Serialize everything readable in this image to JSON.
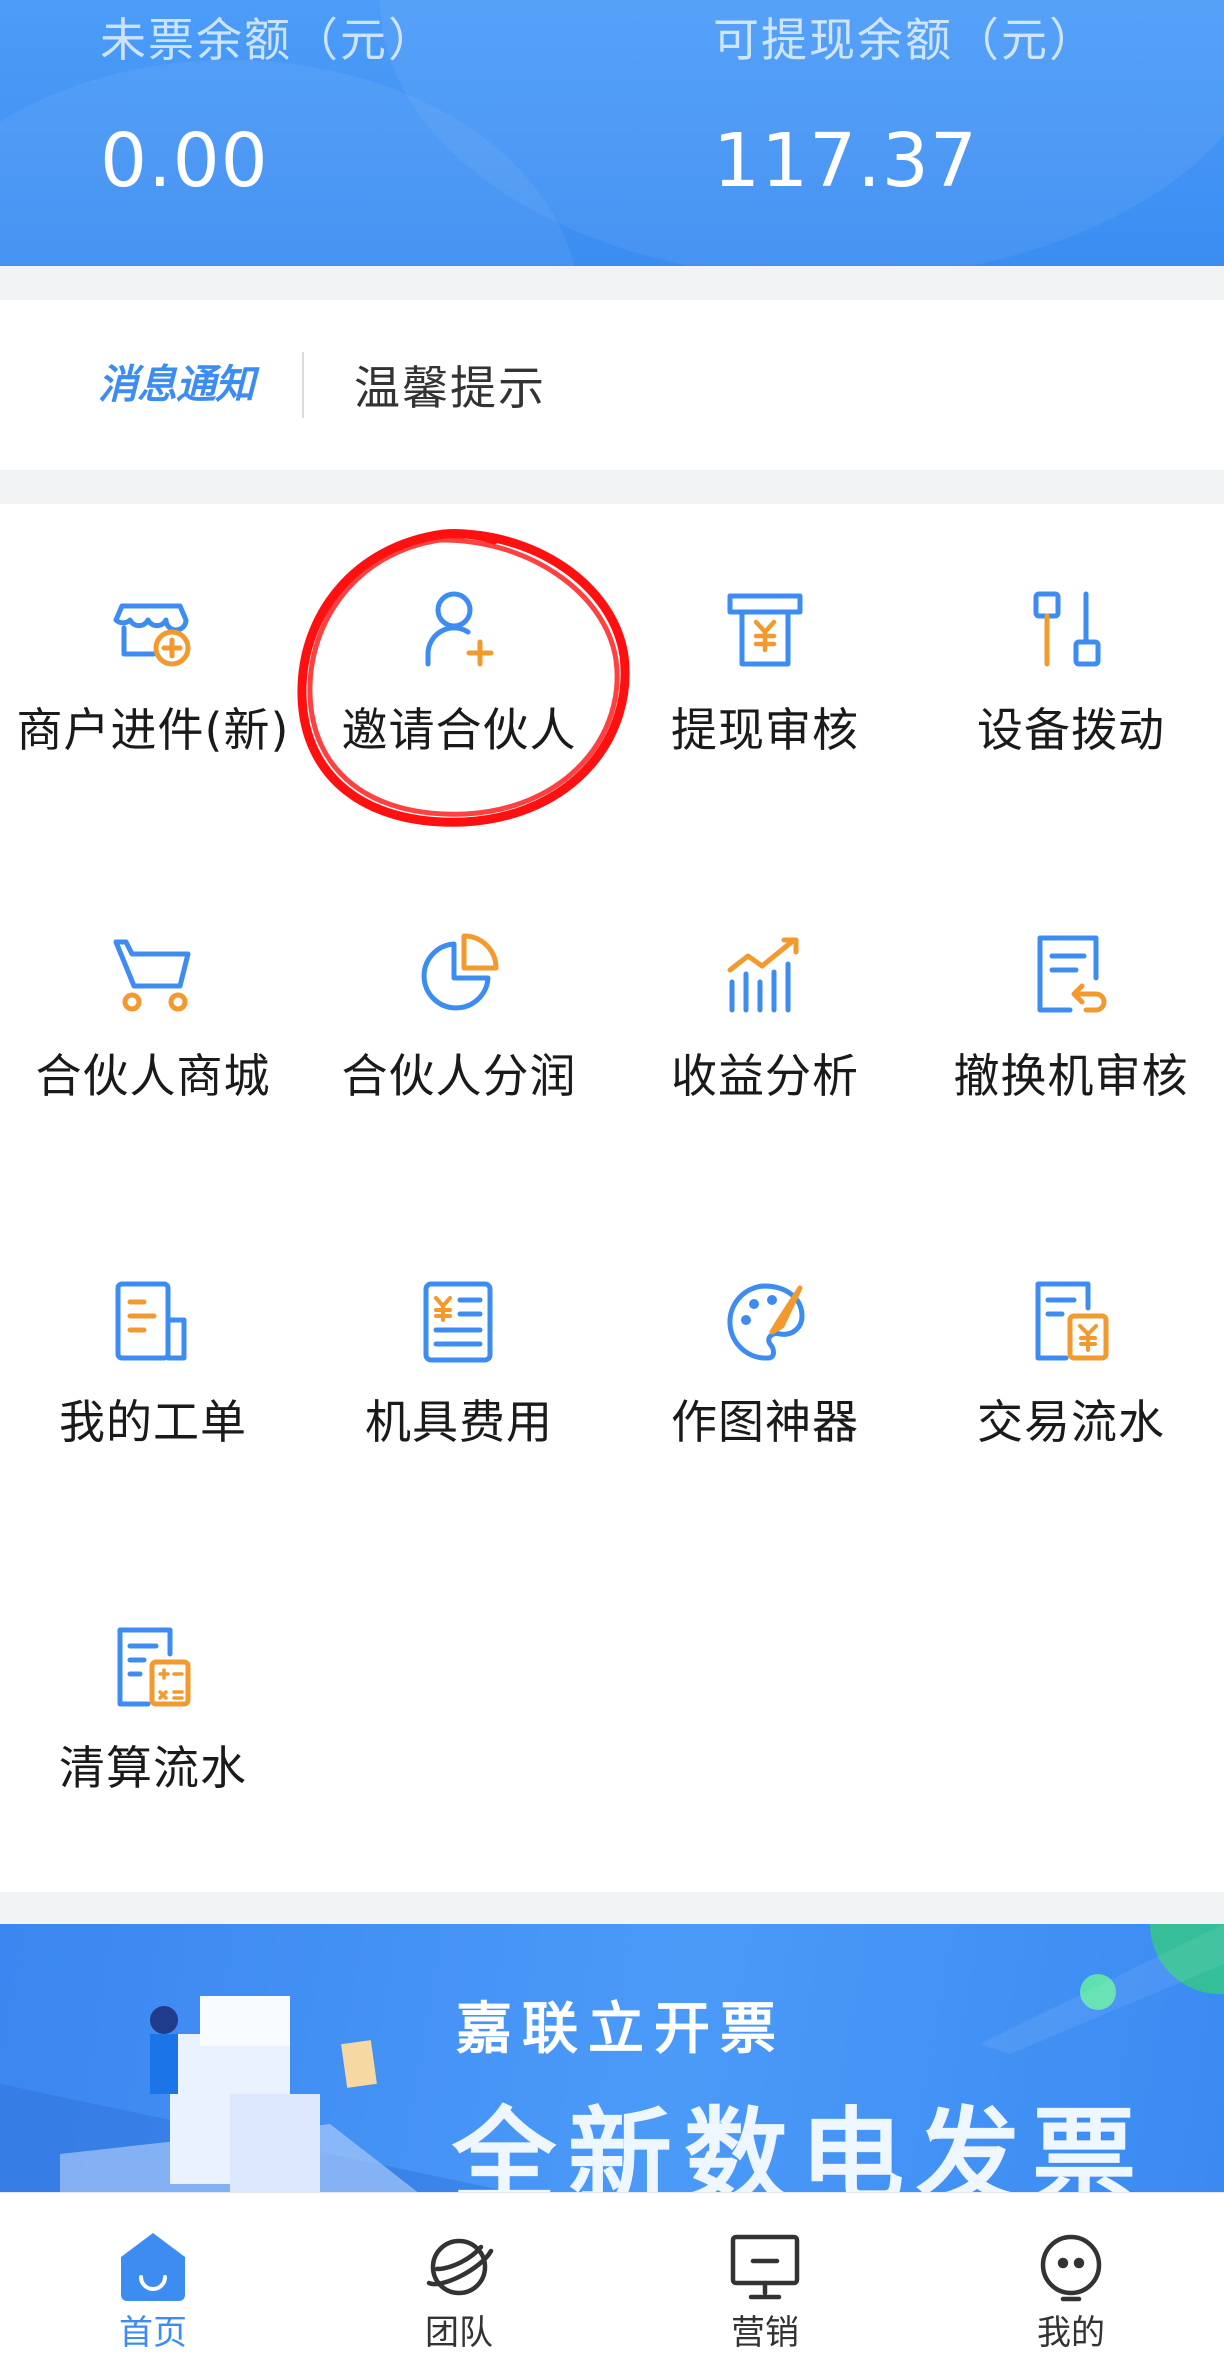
{
  "balances": {
    "uninvoiced_label": "未票余额（元）",
    "uninvoiced_value": "0.00",
    "withdrawable_label": "可提现余额（元）",
    "withdrawable_value": "117.37"
  },
  "notice": {
    "logo_text": "消息通知",
    "text": "温馨提示"
  },
  "grid": {
    "items": [
      {
        "label": "商户进件(新)",
        "icon": "store-add-icon"
      },
      {
        "label": "邀请合伙人",
        "icon": "user-add-icon"
      },
      {
        "label": "提现审核",
        "icon": "cash-withdraw-icon"
      },
      {
        "label": "设备拨动",
        "icon": "device-switch-icon"
      },
      {
        "label": "合伙人商城",
        "icon": "cart-icon"
      },
      {
        "label": "合伙人分润",
        "icon": "pie-chart-icon"
      },
      {
        "label": "收益分析",
        "icon": "bar-trend-icon"
      },
      {
        "label": "撤换机审核",
        "icon": "document-return-icon"
      },
      {
        "label": "我的工单",
        "icon": "work-order-icon"
      },
      {
        "label": "机具费用",
        "icon": "fee-document-icon"
      },
      {
        "label": "作图神器",
        "icon": "palette-icon"
      },
      {
        "label": "交易流水",
        "icon": "transaction-document-icon"
      },
      {
        "label": "清算流水",
        "icon": "calculator-document-icon"
      }
    ]
  },
  "banner": {
    "subtitle": "嘉联立开票",
    "title": "全新数电发票"
  },
  "tabbar": {
    "tabs": [
      {
        "label": "首页",
        "icon": "home-icon",
        "active": true
      },
      {
        "label": "团队",
        "icon": "planet-icon",
        "active": false
      },
      {
        "label": "营销",
        "icon": "monitor-icon",
        "active": false
      },
      {
        "label": "我的",
        "icon": "profile-face-icon",
        "active": false
      }
    ]
  },
  "colors": {
    "primary": "#3d8cf1",
    "accent_orange": "#f39a2f",
    "annotation_red": "#ff1010"
  }
}
